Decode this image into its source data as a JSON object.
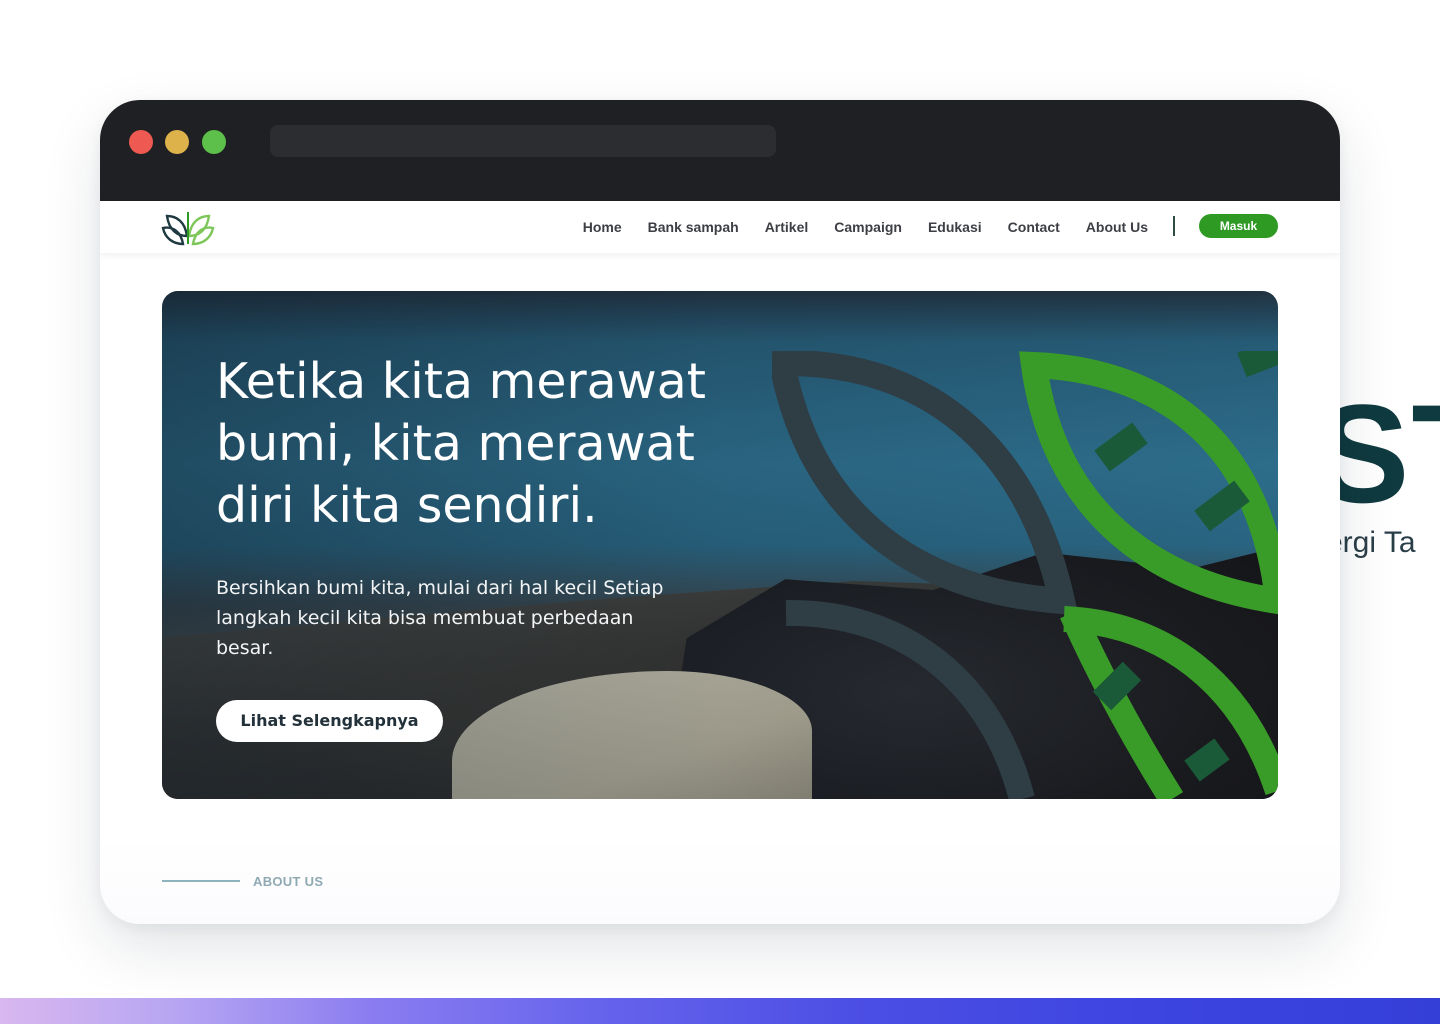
{
  "background": {
    "brand_text": "STA",
    "tagline": "ergi Ta"
  },
  "window": {
    "traffic_lights": [
      "close",
      "minimize",
      "maximize"
    ],
    "url": ""
  },
  "nav": {
    "items": [
      {
        "label": "Home"
      },
      {
        "label": "Bank sampah"
      },
      {
        "label": "Artikel"
      },
      {
        "label": "Campaign"
      },
      {
        "label": "Edukasi"
      },
      {
        "label": "Contact"
      },
      {
        "label": "About Us"
      }
    ],
    "login_label": "Masuk"
  },
  "hero": {
    "title": "Ketika kita merawat bumi, kita merawat diri kita sendiri.",
    "subtitle": "Bersihkan bumi kita, mulai dari hal kecil Setiap langkah kecil kita bisa membuat perbedaan besar.",
    "cta_label": "Lihat Selengkapnya"
  },
  "about": {
    "label": "ABOUT US"
  },
  "colors": {
    "brand_green": "#2e9a24",
    "dark_teal": "#0f3a3f",
    "leaf_dark": "#2f3d45",
    "leaf_green": "#3a9c28",
    "leaf_forest": "#1b5a38"
  },
  "icons": [
    "logo-leaf-icon",
    "leaf-ring-graphic"
  ]
}
